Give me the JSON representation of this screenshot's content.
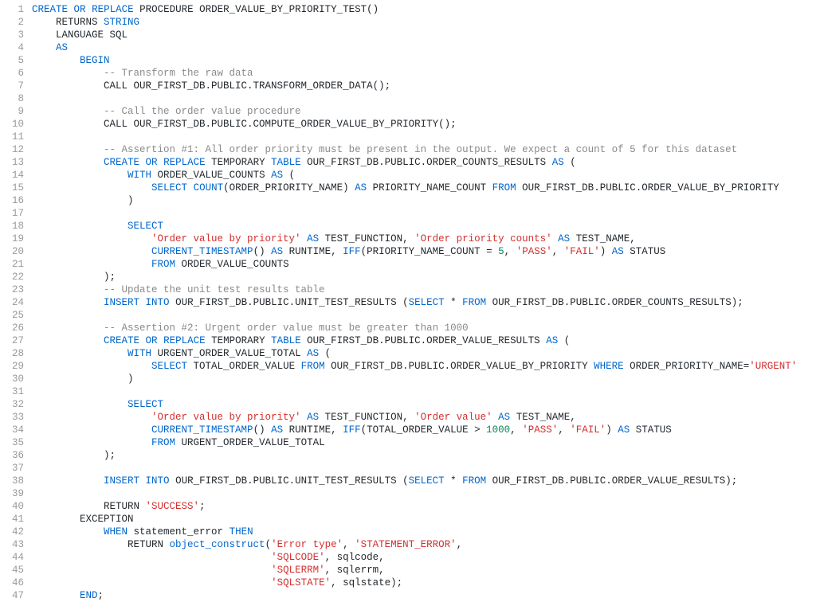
{
  "lineCount": 47,
  "code": {
    "lines": [
      [
        [
          "kw",
          "CREATE"
        ],
        [
          "id",
          " "
        ],
        [
          "kw",
          "OR"
        ],
        [
          "id",
          " "
        ],
        [
          "kw",
          "REPLACE"
        ],
        [
          "id",
          " PROCEDURE ORDER_VALUE_BY_PRIORITY_TEST()"
        ]
      ],
      [
        [
          "id",
          "    RETURNS "
        ],
        [
          "kw",
          "STRING"
        ]
      ],
      [
        [
          "id",
          "    LANGUAGE SQL"
        ]
      ],
      [
        [
          "id",
          "    "
        ],
        [
          "kw",
          "AS"
        ]
      ],
      [
        [
          "id",
          "        "
        ],
        [
          "kw",
          "BEGIN"
        ]
      ],
      [
        [
          "id",
          "            "
        ],
        [
          "cmt",
          "-- Transform the raw data"
        ]
      ],
      [
        [
          "id",
          "            CALL OUR_FIRST_DB.PUBLIC.TRANSFORM_ORDER_DATA();"
        ]
      ],
      [
        [
          "id",
          ""
        ]
      ],
      [
        [
          "id",
          "            "
        ],
        [
          "cmt",
          "-- Call the order value procedure"
        ]
      ],
      [
        [
          "id",
          "            CALL OUR_FIRST_DB.PUBLIC.COMPUTE_ORDER_VALUE_BY_PRIORITY();"
        ]
      ],
      [
        [
          "id",
          ""
        ]
      ],
      [
        [
          "id",
          "            "
        ],
        [
          "cmt",
          "-- Assertion #1: All order priority must be present in the output. We expect a count of 5 for this dataset"
        ]
      ],
      [
        [
          "id",
          "            "
        ],
        [
          "kw",
          "CREATE"
        ],
        [
          "id",
          " "
        ],
        [
          "kw",
          "OR"
        ],
        [
          "id",
          " "
        ],
        [
          "kw",
          "REPLACE"
        ],
        [
          "id",
          " TEMPORARY "
        ],
        [
          "kw",
          "TABLE"
        ],
        [
          "id",
          " OUR_FIRST_DB.PUBLIC.ORDER_COUNTS_RESULTS "
        ],
        [
          "kw",
          "AS"
        ],
        [
          "id",
          " ("
        ]
      ],
      [
        [
          "id",
          "                "
        ],
        [
          "kw",
          "WITH"
        ],
        [
          "id",
          " ORDER_VALUE_COUNTS "
        ],
        [
          "kw",
          "AS"
        ],
        [
          "id",
          " ("
        ]
      ],
      [
        [
          "id",
          "                    "
        ],
        [
          "kw",
          "SELECT"
        ],
        [
          "id",
          " "
        ],
        [
          "fn",
          "COUNT"
        ],
        [
          "id",
          "(ORDER_PRIORITY_NAME) "
        ],
        [
          "kw",
          "AS"
        ],
        [
          "id",
          " PRIORITY_NAME_COUNT "
        ],
        [
          "kw",
          "FROM"
        ],
        [
          "id",
          " OUR_FIRST_DB.PUBLIC.ORDER_VALUE_BY_PRIORITY"
        ]
      ],
      [
        [
          "id",
          "                )"
        ]
      ],
      [
        [
          "id",
          ""
        ]
      ],
      [
        [
          "id",
          "                "
        ],
        [
          "kw",
          "SELECT"
        ]
      ],
      [
        [
          "id",
          "                    "
        ],
        [
          "str",
          "'Order value by priority'"
        ],
        [
          "id",
          " "
        ],
        [
          "kw",
          "AS"
        ],
        [
          "id",
          " TEST_FUNCTION, "
        ],
        [
          "str",
          "'Order priority counts'"
        ],
        [
          "id",
          " "
        ],
        [
          "kw",
          "AS"
        ],
        [
          "id",
          " TEST_NAME,"
        ]
      ],
      [
        [
          "id",
          "                    "
        ],
        [
          "fn",
          "CURRENT_TIMESTAMP"
        ],
        [
          "id",
          "() "
        ],
        [
          "kw",
          "AS"
        ],
        [
          "id",
          " RUNTIME, "
        ],
        [
          "fn",
          "IFF"
        ],
        [
          "id",
          "(PRIORITY_NAME_COUNT = "
        ],
        [
          "num",
          "5"
        ],
        [
          "id",
          ", "
        ],
        [
          "str",
          "'PASS'"
        ],
        [
          "id",
          ", "
        ],
        [
          "str",
          "'FAIL'"
        ],
        [
          "id",
          ") "
        ],
        [
          "kw",
          "AS"
        ],
        [
          "id",
          " STATUS"
        ]
      ],
      [
        [
          "id",
          "                    "
        ],
        [
          "kw",
          "FROM"
        ],
        [
          "id",
          " ORDER_VALUE_COUNTS"
        ]
      ],
      [
        [
          "id",
          "            );"
        ]
      ],
      [
        [
          "id",
          "            "
        ],
        [
          "cmt",
          "-- Update the unit test results table"
        ]
      ],
      [
        [
          "id",
          "            "
        ],
        [
          "kw",
          "INSERT"
        ],
        [
          "id",
          " "
        ],
        [
          "kw",
          "INTO"
        ],
        [
          "id",
          " OUR_FIRST_DB.PUBLIC.UNIT_TEST_RESULTS ("
        ],
        [
          "kw",
          "SELECT"
        ],
        [
          "id",
          " * "
        ],
        [
          "kw",
          "FROM"
        ],
        [
          "id",
          " OUR_FIRST_DB.PUBLIC.ORDER_COUNTS_RESULTS);"
        ]
      ],
      [
        [
          "id",
          ""
        ]
      ],
      [
        [
          "id",
          "            "
        ],
        [
          "cmt",
          "-- Assertion #2: Urgent order value must be greater than 1000"
        ]
      ],
      [
        [
          "id",
          "            "
        ],
        [
          "kw",
          "CREATE"
        ],
        [
          "id",
          " "
        ],
        [
          "kw",
          "OR"
        ],
        [
          "id",
          " "
        ],
        [
          "kw",
          "REPLACE"
        ],
        [
          "id",
          " TEMPORARY "
        ],
        [
          "kw",
          "TABLE"
        ],
        [
          "id",
          " OUR_FIRST_DB.PUBLIC.ORDER_VALUE_RESULTS "
        ],
        [
          "kw",
          "AS"
        ],
        [
          "id",
          " ("
        ]
      ],
      [
        [
          "id",
          "                "
        ],
        [
          "kw",
          "WITH"
        ],
        [
          "id",
          " URGENT_ORDER_VALUE_TOTAL "
        ],
        [
          "kw",
          "AS"
        ],
        [
          "id",
          " ("
        ]
      ],
      [
        [
          "id",
          "                    "
        ],
        [
          "kw",
          "SELECT"
        ],
        [
          "id",
          " TOTAL_ORDER_VALUE "
        ],
        [
          "kw",
          "FROM"
        ],
        [
          "id",
          " OUR_FIRST_DB.PUBLIC.ORDER_VALUE_BY_PRIORITY "
        ],
        [
          "kw",
          "WHERE"
        ],
        [
          "id",
          " ORDER_PRIORITY_NAME="
        ],
        [
          "str",
          "'URGENT'"
        ]
      ],
      [
        [
          "id",
          "                )"
        ]
      ],
      [
        [
          "id",
          ""
        ]
      ],
      [
        [
          "id",
          "                "
        ],
        [
          "kw",
          "SELECT"
        ]
      ],
      [
        [
          "id",
          "                    "
        ],
        [
          "str",
          "'Order value by priority'"
        ],
        [
          "id",
          " "
        ],
        [
          "kw",
          "AS"
        ],
        [
          "id",
          " TEST_FUNCTION, "
        ],
        [
          "str",
          "'Order value'"
        ],
        [
          "id",
          " "
        ],
        [
          "kw",
          "AS"
        ],
        [
          "id",
          " TEST_NAME,"
        ]
      ],
      [
        [
          "id",
          "                    "
        ],
        [
          "fn",
          "CURRENT_TIMESTAMP"
        ],
        [
          "id",
          "() "
        ],
        [
          "kw",
          "AS"
        ],
        [
          "id",
          " RUNTIME, "
        ],
        [
          "fn",
          "IFF"
        ],
        [
          "id",
          "(TOTAL_ORDER_VALUE > "
        ],
        [
          "num",
          "1000"
        ],
        [
          "id",
          ", "
        ],
        [
          "str",
          "'PASS'"
        ],
        [
          "id",
          ", "
        ],
        [
          "str",
          "'FAIL'"
        ],
        [
          "id",
          ") "
        ],
        [
          "kw",
          "AS"
        ],
        [
          "id",
          " STATUS"
        ]
      ],
      [
        [
          "id",
          "                    "
        ],
        [
          "kw",
          "FROM"
        ],
        [
          "id",
          " URGENT_ORDER_VALUE_TOTAL"
        ]
      ],
      [
        [
          "id",
          "            );"
        ]
      ],
      [
        [
          "id",
          ""
        ]
      ],
      [
        [
          "id",
          "            "
        ],
        [
          "kw",
          "INSERT"
        ],
        [
          "id",
          " "
        ],
        [
          "kw",
          "INTO"
        ],
        [
          "id",
          " OUR_FIRST_DB.PUBLIC.UNIT_TEST_RESULTS ("
        ],
        [
          "kw",
          "SELECT"
        ],
        [
          "id",
          " * "
        ],
        [
          "kw",
          "FROM"
        ],
        [
          "id",
          " OUR_FIRST_DB.PUBLIC.ORDER_VALUE_RESULTS);"
        ]
      ],
      [
        [
          "id",
          ""
        ]
      ],
      [
        [
          "id",
          "            RETURN "
        ],
        [
          "str",
          "'SUCCESS'"
        ],
        [
          "id",
          ";"
        ]
      ],
      [
        [
          "id",
          "        EXCEPTION"
        ]
      ],
      [
        [
          "id",
          "            "
        ],
        [
          "kw",
          "WHEN"
        ],
        [
          "id",
          " statement_error "
        ],
        [
          "kw",
          "THEN"
        ]
      ],
      [
        [
          "id",
          "                RETURN "
        ],
        [
          "fn",
          "object_construct"
        ],
        [
          "id",
          "("
        ],
        [
          "str",
          "'Error type'"
        ],
        [
          "id",
          ", "
        ],
        [
          "str",
          "'STATEMENT_ERROR'"
        ],
        [
          "id",
          ","
        ]
      ],
      [
        [
          "id",
          "                                        "
        ],
        [
          "str",
          "'SQLCODE'"
        ],
        [
          "id",
          ", sqlcode,"
        ]
      ],
      [
        [
          "id",
          "                                        "
        ],
        [
          "str",
          "'SQLERRM'"
        ],
        [
          "id",
          ", sqlerrm,"
        ]
      ],
      [
        [
          "id",
          "                                        "
        ],
        [
          "str",
          "'SQLSTATE'"
        ],
        [
          "id",
          ", sqlstate);"
        ]
      ],
      [
        [
          "id",
          "        "
        ],
        [
          "kw",
          "END"
        ],
        [
          "id",
          ";"
        ]
      ]
    ]
  }
}
